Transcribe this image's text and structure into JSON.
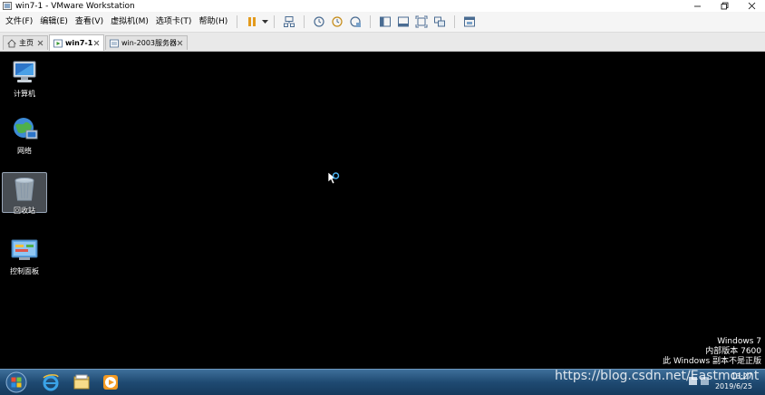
{
  "window": {
    "title": "win7-1 - VMware Workstation"
  },
  "menu": {
    "items": [
      "文件(F)",
      "编辑(E)",
      "查看(V)",
      "虚拟机(M)",
      "选项卡(T)",
      "帮助(H)"
    ]
  },
  "tabs": [
    {
      "label": "主页",
      "icon": "home-icon",
      "active": false
    },
    {
      "label": "win7-1",
      "icon": "vm-running-icon",
      "active": true
    },
    {
      "label": "win-2003服务器",
      "icon": "vm-icon",
      "active": false
    }
  ],
  "desktop": {
    "icons": [
      {
        "label": "计算机",
        "icon": "computer-icon"
      },
      {
        "label": "网络",
        "icon": "network-icon"
      },
      {
        "label": "回收站",
        "icon": "recycle-bin-icon"
      },
      {
        "label": "控制面板",
        "icon": "control-panel-icon"
      }
    ]
  },
  "watermark": {
    "line1": "Windows 7",
    "line2": "内部版本 7600",
    "line3": "此 Windows 副本不是正版"
  },
  "tray": {
    "time": "13:27",
    "date": "2019/6/25"
  },
  "overlay": {
    "csdn": "https://blog.csdn.net/Eastmount"
  },
  "colors": {
    "taskbar": "#1f4a72",
    "desktop": "#000000"
  }
}
